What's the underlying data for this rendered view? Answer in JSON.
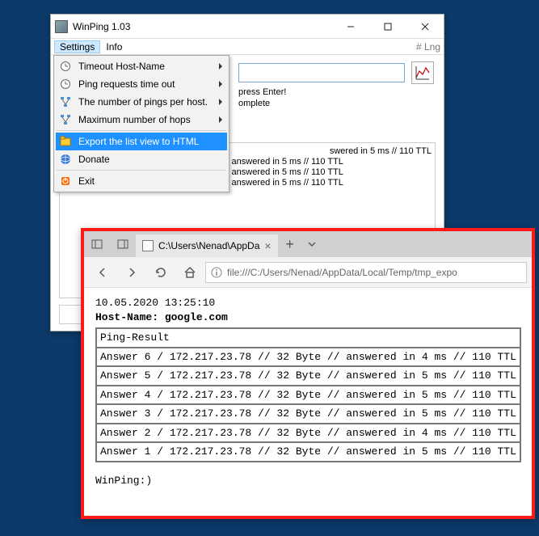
{
  "winping": {
    "title": "WinPing 1.03",
    "menus": {
      "settings": "Settings",
      "info": "Info",
      "lng": "# Lng"
    },
    "dropdown": {
      "timeout": "Timeout Host-Name",
      "pingrequests": "Ping requests time out",
      "numpings": "The number of pings per host.",
      "maxhops": "Maximum number of hops",
      "export": "Export the list view to HTML",
      "donate": "Donate",
      "exit": "Exit"
    },
    "hint1": "press Enter!",
    "hint2": "omplete",
    "results": {
      "partial": "swered in 5 ms // 110 TTL",
      "l1": "Answer -5 von: 172.217.23.78  // 32 Byte // answered in 5 ms  // 110 TTL",
      "l2": "Answer -4 von: 172.217.23.78  // 32 Byte // answered in 5 ms  // 110 TTL",
      "l3": "Answer -3 von: 172.217.23.78  // 32 Byte // answered in 5 ms  // 110 TTL"
    }
  },
  "browser": {
    "tab_title": "C:\\Users\\Nenad\\AppDa",
    "url": "file:///C:/Users/Nenad/AppData/Local/Temp/tmp_expo",
    "timestamp": "10.05.2020 13:25:10",
    "hostline": "Host-Name: google.com",
    "table_header": "Ping-Result",
    "rows": [
      "Answer 6 / 172.217.23.78 // 32 Byte // answered in 4 ms // 110 TTL",
      "Answer 5 / 172.217.23.78 // 32 Byte // answered in 5 ms // 110 TTL",
      "Answer 4 / 172.217.23.78 // 32 Byte // answered in 5 ms // 110 TTL",
      "Answer 3 / 172.217.23.78 // 32 Byte // answered in 5 ms // 110 TTL",
      "Answer 2 / 172.217.23.78 // 32 Byte // answered in 4 ms // 110 TTL",
      "Answer 1 / 172.217.23.78 // 32 Byte // answered in 5 ms // 110 TTL"
    ],
    "footer": "WinPing:)"
  }
}
